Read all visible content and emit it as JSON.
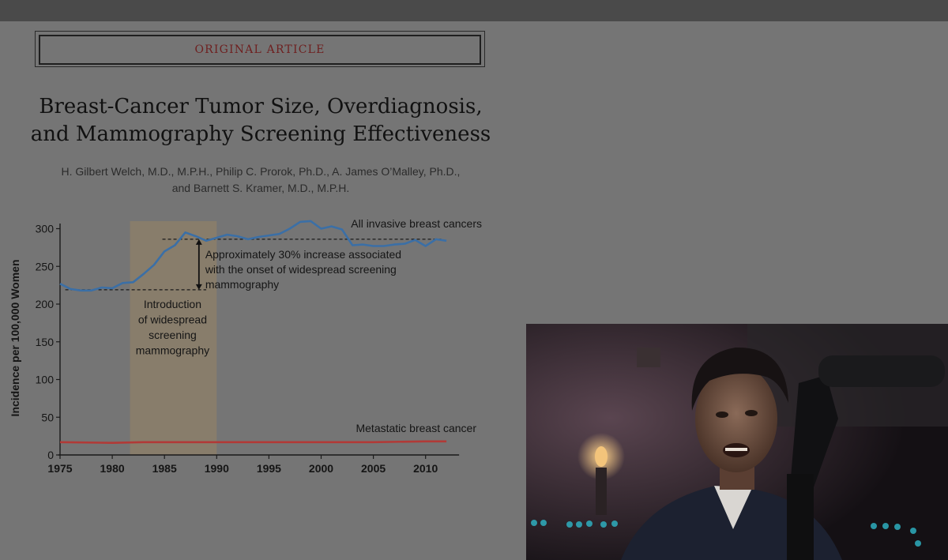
{
  "article": {
    "section_label": "ORIGINAL ARTICLE",
    "title_line1": "Breast-Cancer Tumor Size, Overdiagnosis,",
    "title_line2": "and Mammography Screening Effectiveness",
    "authors_line1": "H. Gilbert Welch, M.D., M.P.H., Philip C. Prorok, Ph.D., A. James O’Malley, Ph.D.,",
    "authors_line2": "and Barnett S. Kramer, M.D., M.P.H."
  },
  "chart_data": {
    "type": "line",
    "title": "",
    "xlabel": "",
    "ylabel": "Incidence per 100,000 Women",
    "xlim": [
      1975,
      2012
    ],
    "ylim": [
      0,
      310
    ],
    "xticks": [
      1975,
      1980,
      1985,
      1990,
      1995,
      2000,
      2005,
      2010
    ],
    "yticks": [
      0,
      50,
      100,
      150,
      200,
      250,
      300
    ],
    "grid": false,
    "shaded_region": {
      "x": [
        1981.7,
        1990
      ],
      "label_lines": [
        "Introduction",
        "of widespread",
        "screening",
        "mammography"
      ]
    },
    "reference_lines": [
      {
        "y": 219,
        "x": [
          1975.5,
          1989
        ]
      },
      {
        "y": 286,
        "x": [
          1984.8,
          2011.5
        ]
      }
    ],
    "annotation": {
      "arrow_x": 1988.3,
      "arrow_y": [
        219,
        286
      ],
      "lines": [
        "Approximately 30% increase associated",
        "with the onset of widespread screening",
        "mammography"
      ]
    },
    "series": [
      {
        "name": "All invasive breast cancers",
        "color": "#3b6fa6",
        "x": [
          1975,
          1976,
          1977,
          1978,
          1979,
          1980,
          1981,
          1982,
          1983,
          1984,
          1985,
          1986,
          1987,
          1988,
          1989,
          1990,
          1991,
          1992,
          1993,
          1994,
          1995,
          1996,
          1997,
          1998,
          1999,
          2000,
          2001,
          2002,
          2003,
          2004,
          2005,
          2006,
          2007,
          2008,
          2009,
          2010,
          2011,
          2012
        ],
        "values": [
          227,
          220,
          218,
          218,
          222,
          221,
          228,
          229,
          240,
          252,
          270,
          278,
          295,
          290,
          284,
          288,
          292,
          290,
          286,
          289,
          291,
          293,
          300,
          309,
          310,
          300,
          303,
          299,
          278,
          279,
          277,
          277,
          279,
          280,
          285,
          277,
          286,
          284
        ]
      },
      {
        "name": "Metastatic breast cancer",
        "color": "#b13a37",
        "x": [
          1975,
          1980,
          1983,
          1985,
          1990,
          1995,
          2000,
          2005,
          2010,
          2012
        ],
        "values": [
          17,
          16,
          17,
          17,
          17,
          17,
          17,
          17,
          18,
          18
        ]
      }
    ]
  },
  "video": {
    "description_icon": "presenter-webcam-feed"
  }
}
